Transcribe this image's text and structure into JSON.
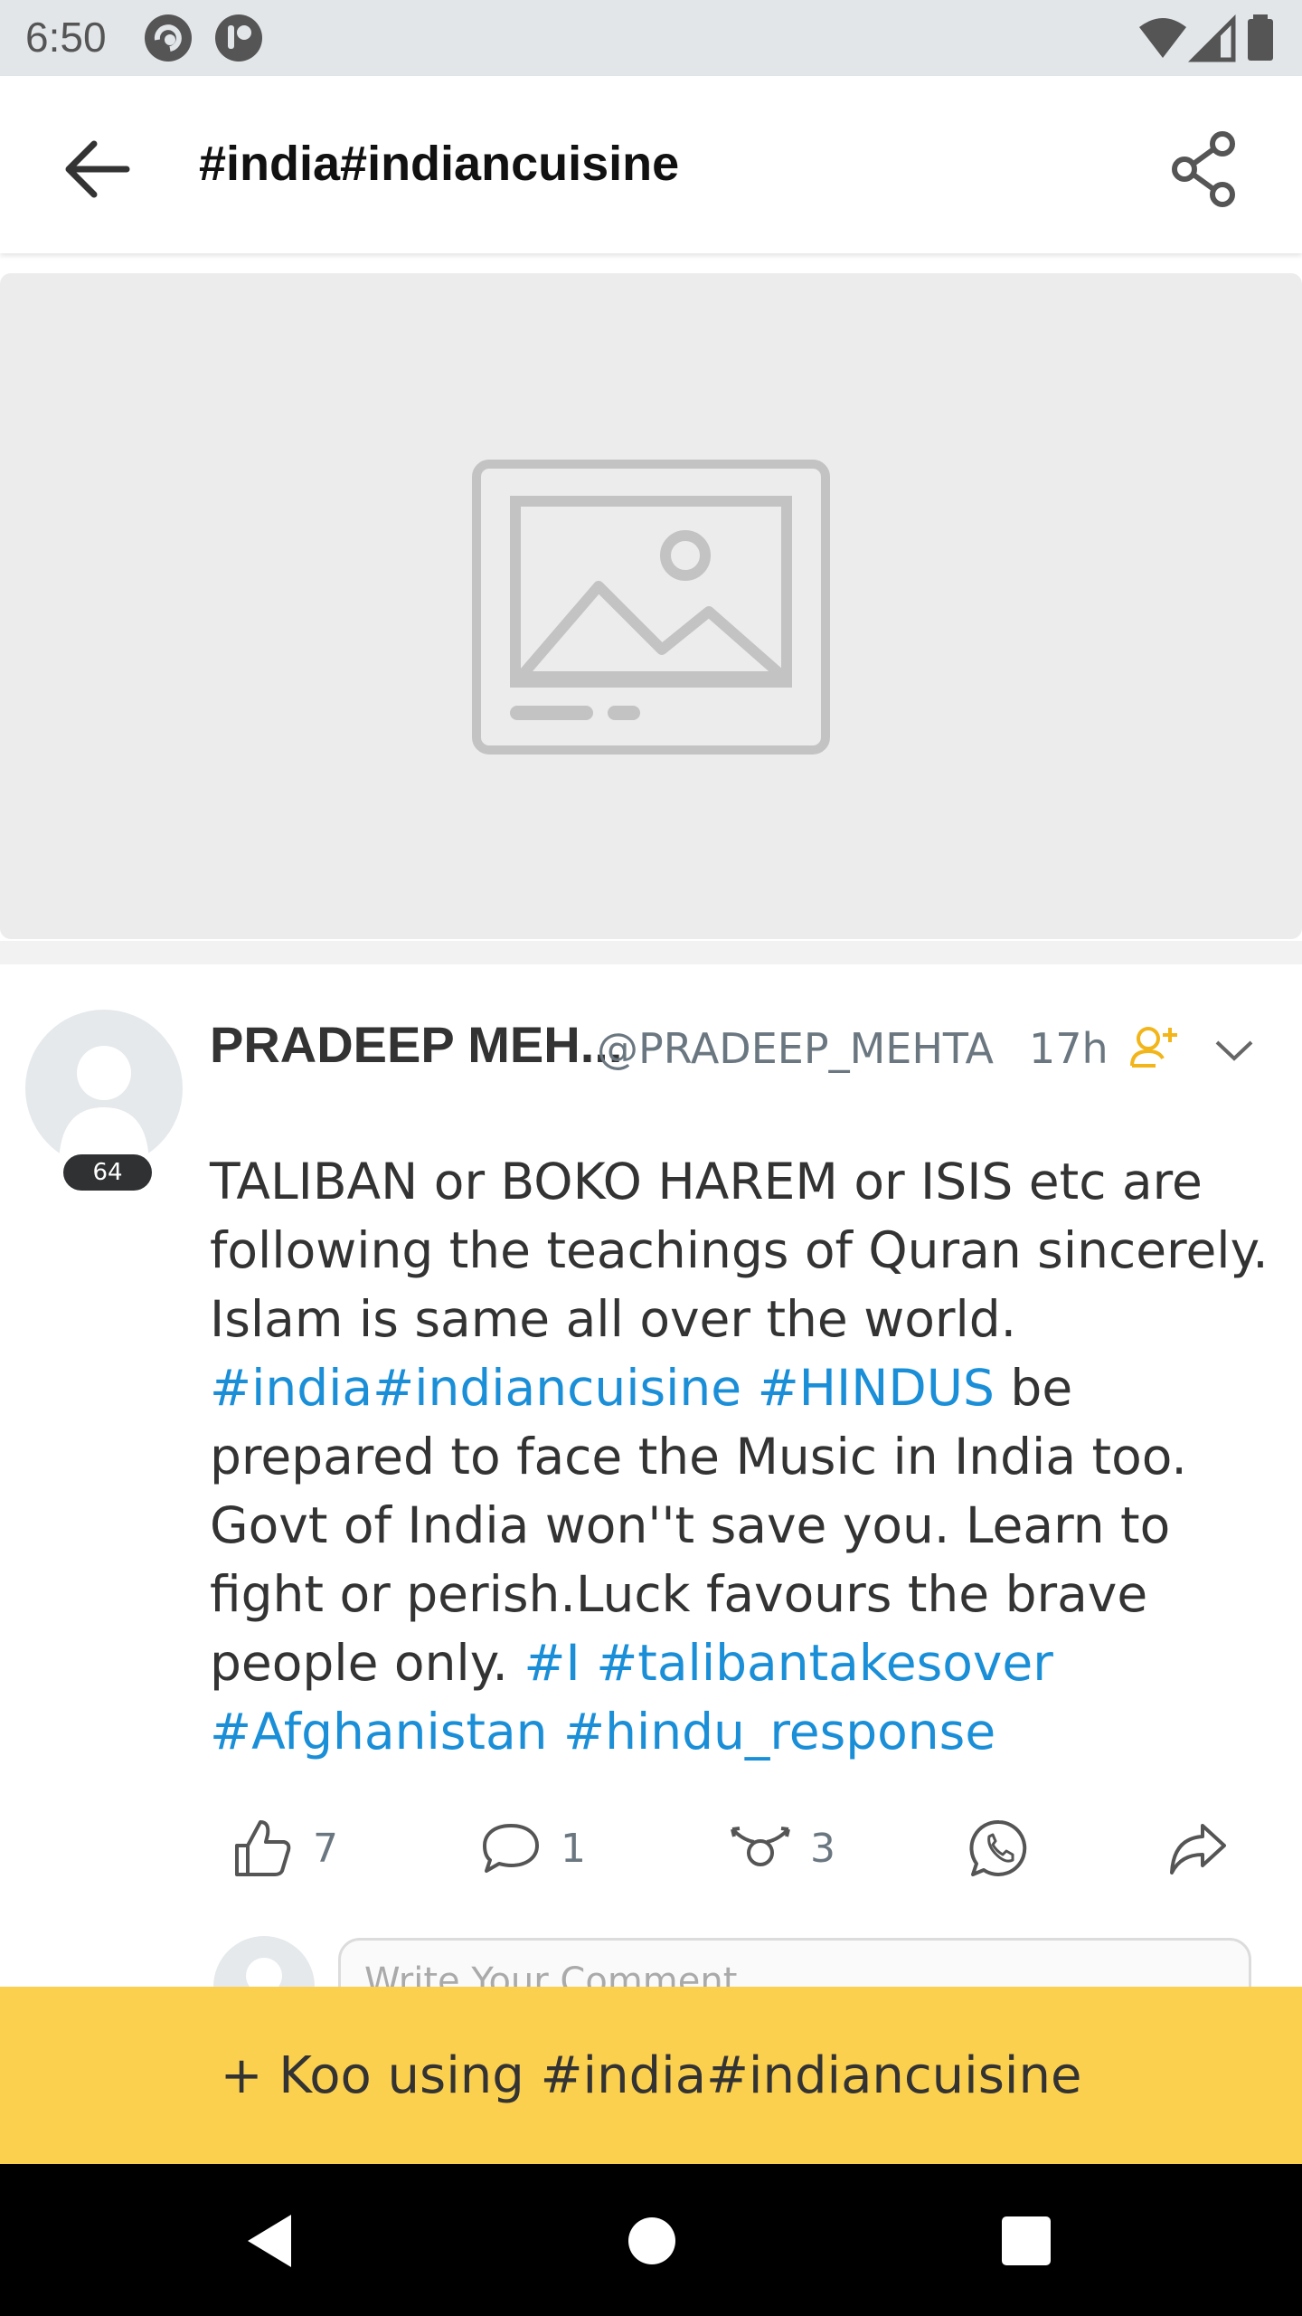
{
  "status_bar": {
    "time": "6:50",
    "icons": [
      "app-notification-icon",
      "app-notification-icon-2",
      "wifi-icon",
      "signal-icon",
      "battery-icon"
    ]
  },
  "app_bar": {
    "title": "#india#indiancuisine",
    "back_icon": "arrow-left-icon",
    "share_icon": "share-icon"
  },
  "banner": {
    "icon": "image-placeholder-icon"
  },
  "post": {
    "author_name": "PRADEEP MEH...",
    "author_handle": "@PRADEEP_MEHTA",
    "time": "17h",
    "level": "64",
    "text_parts": [
      {
        "t": "TALIBAN or BOKO HAREM or ISIS etc are following the teachings of Quran sincerely. Islam is same all over the world. ",
        "tag": false
      },
      {
        "t": "#india#indiancuisine",
        "tag": true
      },
      {
        "t": "   ",
        "tag": false
      },
      {
        "t": "#HINDUS",
        "tag": true
      },
      {
        "t": " be prepared to face the Music in India too. Govt of India won''t save you. Learn to fight or perish.Luck favours the brave people only. ",
        "tag": false
      },
      {
        "t": "#I",
        "tag": true
      },
      {
        "t": "  ",
        "tag": false
      },
      {
        "t": "#talibantakesover",
        "tag": true
      },
      {
        "t": " ",
        "tag": false
      },
      {
        "t": "#Afghanistan",
        "tag": true
      },
      {
        "t": " ",
        "tag": false
      },
      {
        "t": "#hindu_response",
        "tag": true
      }
    ],
    "actions": {
      "likes": "7",
      "comments": "1",
      "rekoos": "3"
    },
    "comment_placeholder": "Write Your Comment"
  },
  "cta": {
    "label": "+ Koo using #india#indiancuisine"
  },
  "colors": {
    "hashtag": "#1a8fd8",
    "cta_background": "#fcd04f",
    "follow_icon": "#f2b51a"
  }
}
